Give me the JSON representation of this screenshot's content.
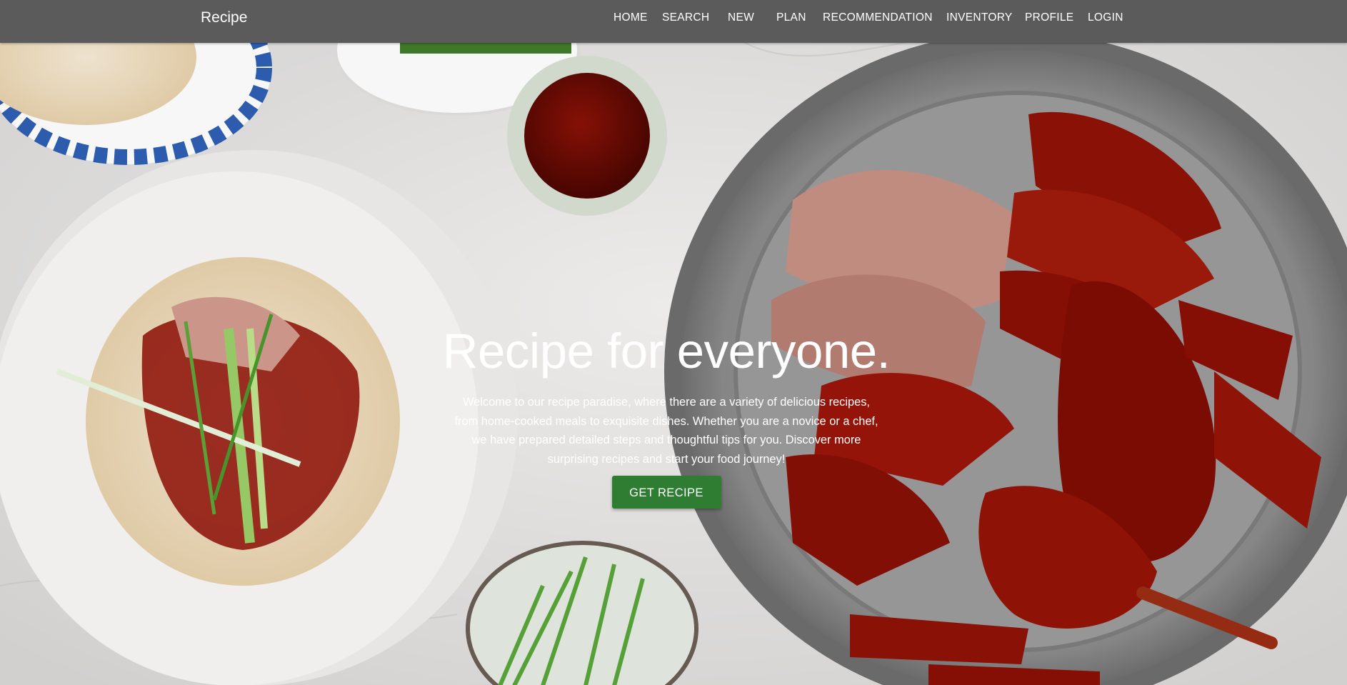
{
  "brand": "Recipe",
  "nav": [
    "HOME",
    "SEARCH",
    "NEW",
    "PLAN",
    "RECOMMENDATION",
    "INVENTORY",
    "PROFILE",
    "LOGIN"
  ],
  "hero": {
    "title": "Recipe for everyone.",
    "description": "Welcome to our recipe paradise, where there are a variety of delicious recipes, from home-cooked meals to exquisite dishes. Whether you are a novice or a chef, we have prepared detailed steps and thoughtful tips for you. Discover more surprising recipes and start your food journey!",
    "button": "GET RECIPE",
    "image": "peking duck and pancakes background"
  },
  "colors": {
    "navbar": "#5b5b5b",
    "button": "#2e7d32",
    "text": "#ffffff"
  }
}
